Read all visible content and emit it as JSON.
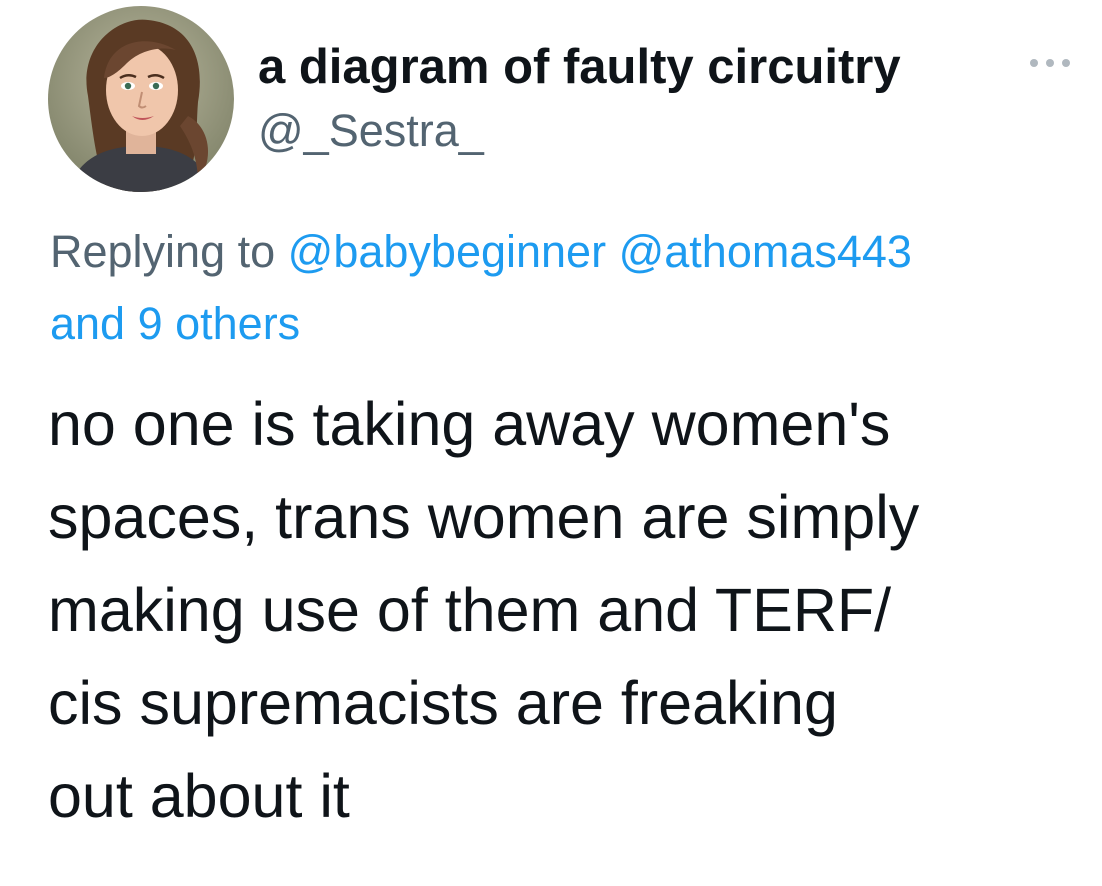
{
  "tweet": {
    "display_name": "a diagram of faulty circuitry",
    "handle": "@_Sestra_",
    "more_icon": "ellipsis-icon",
    "reply": {
      "prefix": "Replying to",
      "mentions": [
        "@babybeginner",
        "@athomas443"
      ],
      "others": "and 9 others"
    },
    "lines": [
      "no one is taking away women's",
      "spaces, trans women are simply",
      "making use of them and TERF/",
      "cis supremacists are freaking",
      "out about it"
    ]
  },
  "colors": {
    "text": "#0f1419",
    "secondary": "#536471",
    "link": "#1d9bf0",
    "background": "#ffffff"
  }
}
